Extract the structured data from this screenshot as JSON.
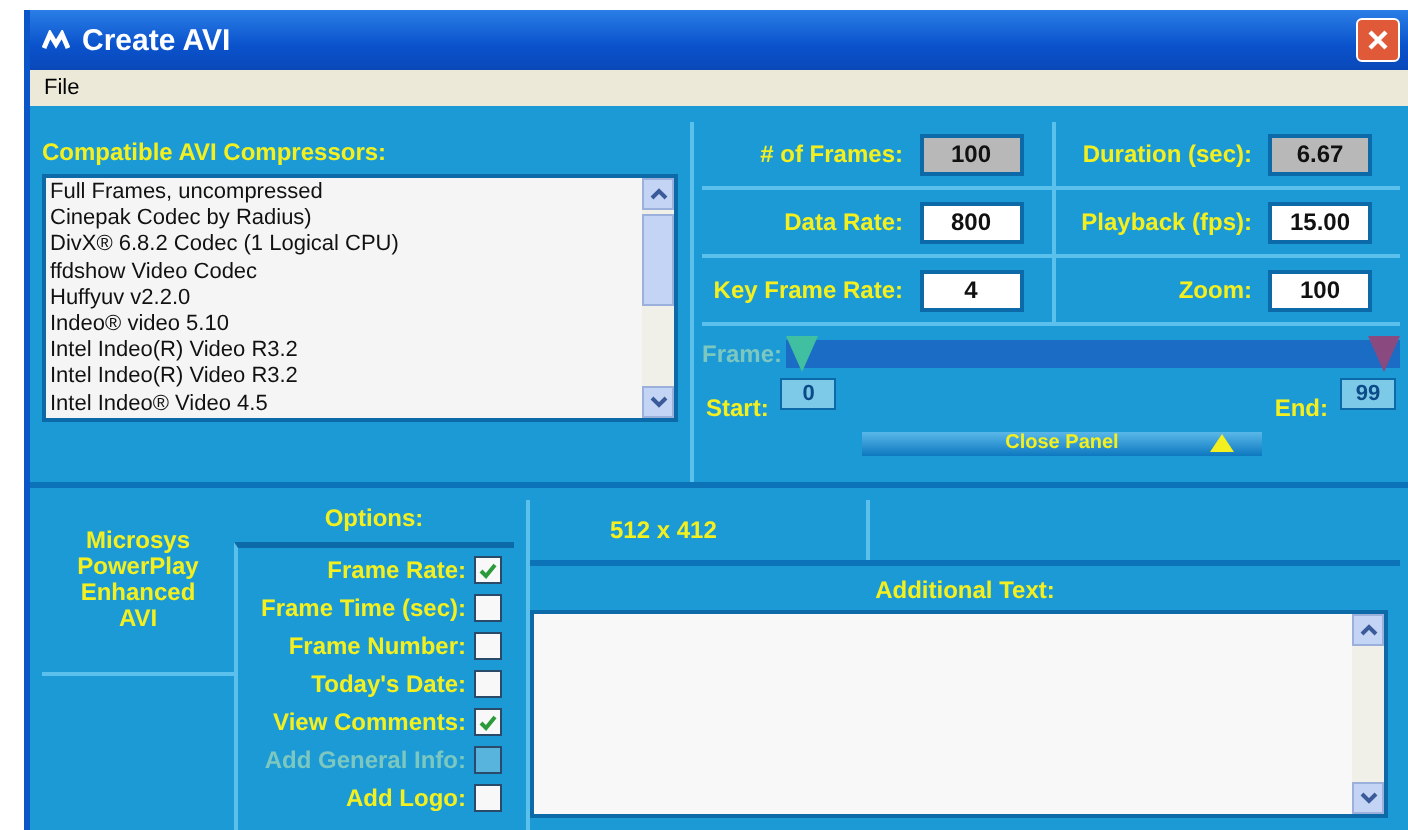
{
  "window": {
    "title": "Create AVI"
  },
  "menu": [
    "File"
  ],
  "compressors": {
    "title": "Compatible AVI Compressors:",
    "items": [
      {
        "label": "Full Frames, uncompressed",
        "selected": false
      },
      {
        "label": "Cinepak Codec by Radius)",
        "selected": false
      },
      {
        "label": "DivX® 6.8.2 Codec (1 Logical CPU)",
        "selected": false
      },
      {
        "label": "ffdshow Video Codec",
        "selected": false
      },
      {
        "label": "Huffyuv v2.2.0",
        "selected": false
      },
      {
        "label": "Indeo® video 5.10",
        "selected": false
      },
      {
        "label": "Intel Indeo(R) Video R3.2",
        "selected": false
      },
      {
        "label": "Intel Indeo(R) Video R3.2",
        "selected": false
      },
      {
        "label": "Intel Indeo® Video 4.5",
        "selected": false
      }
    ]
  },
  "settings": [
    {
      "label": "# of Frames:",
      "value": "100",
      "readonly": true
    },
    {
      "label": "Duration (sec):",
      "value": "6.67",
      "readonly": true
    },
    {
      "label": "Data Rate:",
      "value": "800",
      "readonly": false
    },
    {
      "label": "Playback (fps):",
      "value": "15.00",
      "readonly": false
    },
    {
      "label": "Key Frame Rate:",
      "value": "4",
      "readonly": false
    },
    {
      "label": "Zoom:",
      "value": "100",
      "readonly": false
    }
  ],
  "frame": {
    "label": "Frame:",
    "disabled": true,
    "start_handle": {
      "level": 0
    },
    "end_handle": {
      "level": 1
    },
    "start_label": "Start:",
    "start_value": "0",
    "end_label": "End:",
    "end_value": "99"
  },
  "close_panel": "Close Panel",
  "brand": "Microsys PowerPlay Enhanced AVI",
  "options": {
    "title": "Options:",
    "items": [
      {
        "label": "Frame Rate:",
        "checked": true,
        "disabled": false
      },
      {
        "label": "Frame Time (sec):",
        "checked": false,
        "disabled": false
      },
      {
        "label": "Frame Number:",
        "checked": false,
        "disabled": false
      },
      {
        "label": "Today's Date:",
        "checked": false,
        "disabled": false
      },
      {
        "label": "View Comments:",
        "checked": true,
        "disabled": false
      },
      {
        "label": "Add General Info:",
        "checked": false,
        "disabled": true
      },
      {
        "label": "Add Logo:",
        "checked": false,
        "disabled": false
      }
    ]
  },
  "resolution": "512 x 412",
  "additional_text": {
    "label": "Additional Text:"
  }
}
